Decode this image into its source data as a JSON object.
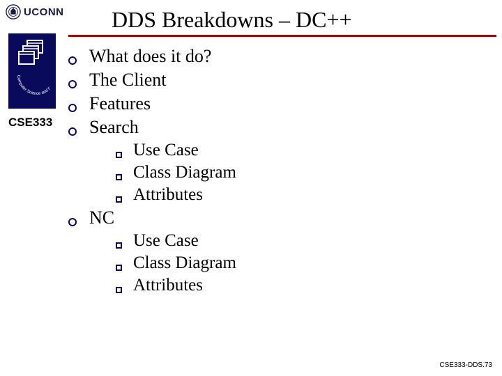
{
  "header": {
    "uconn": "UCONN"
  },
  "title": "DDS Breakdowns – DC++",
  "course_label": "CSE333",
  "sidebar": {
    "ring_text": "Computer Science and Engineering"
  },
  "bullets": {
    "b0": "What does it do?",
    "b1": "The Client",
    "b2": "Features",
    "b3": "Search",
    "b3_sub": {
      "s0": "Use Case",
      "s1": "Class Diagram",
      "s2": "Attributes"
    },
    "b4": "NC",
    "b4_sub": {
      "s0": "Use Case",
      "s1": "Class Diagram",
      "s2": "Attributes"
    }
  },
  "footer": "CSE333-DDS.73"
}
